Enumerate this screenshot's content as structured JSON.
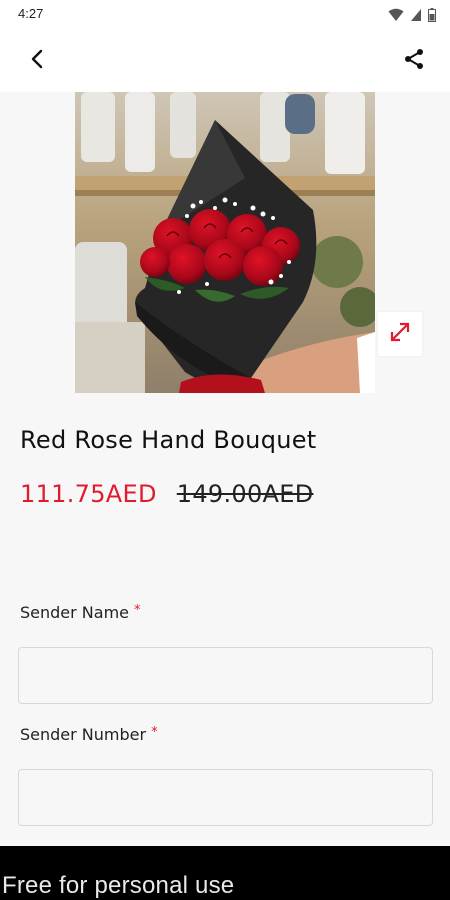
{
  "status_bar": {
    "time": "4:27",
    "icons": [
      "wifi-icon",
      "signal-icon",
      "battery-icon"
    ]
  },
  "app_bar": {
    "icons": [
      "back-arrow-icon",
      "share-icon"
    ]
  },
  "product": {
    "title": "Red Rose Hand Bouquet",
    "sale_price": "111.75AED",
    "original_price": "149.00AED"
  },
  "form": {
    "sender_name": {
      "label": "Sender Name",
      "required": "*",
      "value": ""
    },
    "sender_number": {
      "label": "Sender Number",
      "required": "*",
      "value": ""
    }
  },
  "watermark": {
    "text": "Free for personal use"
  },
  "colors": {
    "accent": "#e11b2f",
    "background": "#f7f7f7",
    "app_bar": "#ffffff",
    "watermark_bg": "#000000"
  }
}
